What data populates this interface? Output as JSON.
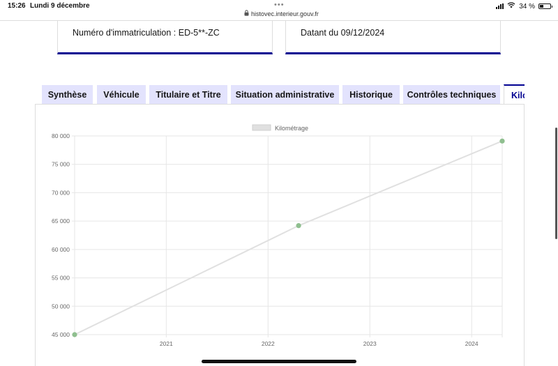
{
  "statusbar": {
    "time": "15:26",
    "date": "Lundi 9 décembre",
    "url": "histovec.interieur.gouv.fr",
    "battery": "34 %",
    "battery_level": 0.34
  },
  "cards": {
    "immatriculation": "Numéro d'immatriculation : ED-5**-ZC",
    "datant": "Datant du 09/12/2024"
  },
  "tabs": [
    {
      "label": "Synthèse"
    },
    {
      "label": "Véhicule"
    },
    {
      "label": "Titulaire et Titre"
    },
    {
      "label": "Situation administrative"
    },
    {
      "label": "Historique"
    },
    {
      "label": "Contrôles techniques"
    },
    {
      "label": "Kilo",
      "active": true
    }
  ],
  "colors": {
    "accent": "#000091",
    "tab_bg": "#e3e3fd",
    "line": "#dddddd",
    "point": "#8fbf8f"
  },
  "chart_data": {
    "type": "line",
    "legend": "Kilométrage",
    "x_ticks": [
      "2021",
      "2022",
      "2023",
      "2024"
    ],
    "x_ticks_values": [
      2021,
      2022,
      2023,
      2024
    ],
    "xlim": [
      2020.1,
      2024.3
    ],
    "ylim": [
      45000,
      80000
    ],
    "y_ticks": [
      45000,
      50000,
      55000,
      60000,
      65000,
      70000,
      75000,
      80000
    ],
    "y_tick_labels": [
      "45 000",
      "50 000",
      "55 000",
      "60 000",
      "65 000",
      "70 000",
      "75 000",
      "80 000"
    ],
    "series": [
      {
        "name": "Kilométrage",
        "points": [
          {
            "x": 2020.1,
            "y": 45000
          },
          {
            "x": 2022.3,
            "y": 64200
          },
          {
            "x": 2024.3,
            "y": 79100
          }
        ]
      }
    ]
  }
}
